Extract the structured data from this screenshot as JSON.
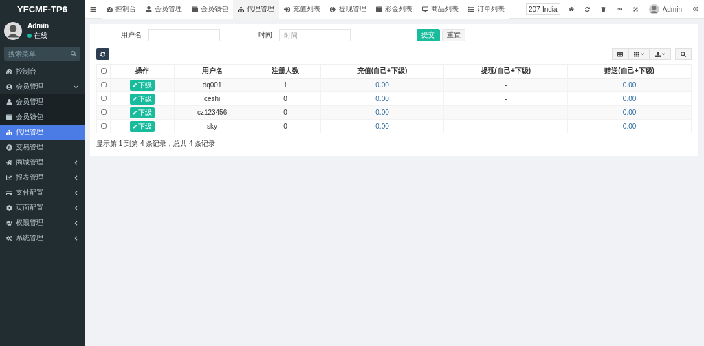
{
  "brand": "YFCMF-TP6",
  "user": {
    "name": "Admin",
    "status": "在线"
  },
  "sidebar": {
    "search": {
      "placeholder": "搜索菜单"
    },
    "items": [
      {
        "label": "控制台",
        "kind": "link",
        "selected": false
      },
      {
        "label": "会员管理",
        "kind": "group",
        "selected": false,
        "expanded": true,
        "children": [
          {
            "label": "会员管理",
            "selected": false
          },
          {
            "label": "会员钱包",
            "selected": false
          }
        ]
      },
      {
        "label": "代理管理",
        "kind": "link",
        "selected": true
      },
      {
        "label": "交易管理",
        "kind": "link",
        "selected": false
      },
      {
        "label": "商城管理",
        "kind": "group",
        "selected": false,
        "expanded": false
      },
      {
        "label": "报表管理",
        "kind": "group",
        "selected": false,
        "expanded": false
      },
      {
        "label": "支付配置",
        "kind": "group",
        "selected": false,
        "expanded": false
      },
      {
        "label": "页面配置",
        "kind": "group",
        "selected": false,
        "expanded": false
      },
      {
        "label": "权限管理",
        "kind": "group",
        "selected": false,
        "expanded": false
      },
      {
        "label": "系统管理",
        "kind": "group",
        "selected": false,
        "expanded": false
      }
    ]
  },
  "tabs": [
    {
      "label": "控制台",
      "selected": false
    },
    {
      "label": "会员管理",
      "selected": false
    },
    {
      "label": "会员钱包",
      "selected": false
    },
    {
      "label": "代理管理",
      "selected": true
    },
    {
      "label": "充值列表",
      "selected": false
    },
    {
      "label": "提现管理",
      "selected": false
    },
    {
      "label": "彩金列表",
      "selected": false
    },
    {
      "label": "商品列表",
      "selected": false
    },
    {
      "label": "订单列表",
      "selected": false
    }
  ],
  "header_right": {
    "language": "207-India",
    "user": "Admin"
  },
  "filters": [
    {
      "label": "用户名"
    },
    {
      "label": "时间",
      "placeholder": "时间"
    }
  ],
  "filter_buttons": [
    {
      "label": "提交",
      "kind": "primary"
    },
    {
      "label": "重置",
      "kind": "default"
    }
  ],
  "table": {
    "columns": [
      "操作",
      "用户名",
      "注册人数",
      "充值(自己+下级)",
      "提现(自己+下级)",
      "赠送(自己+下级)"
    ],
    "header_checked": false,
    "rows": [
      {
        "checked": false,
        "action": "下级",
        "username": "dq001",
        "registered": "1",
        "recharge": "0.00",
        "withdraw": "-",
        "bonus": "0.00"
      },
      {
        "checked": false,
        "action": "下级",
        "username": "ceshi",
        "registered": "0",
        "recharge": "0.00",
        "withdraw": "-",
        "bonus": "0.00"
      },
      {
        "checked": false,
        "action": "下级",
        "username": "cz123456",
        "registered": "0",
        "recharge": "0.00",
        "withdraw": "-",
        "bonus": "0.00"
      },
      {
        "checked": false,
        "action": "下级",
        "username": "sky",
        "registered": "0",
        "recharge": "0.00",
        "withdraw": "-",
        "bonus": "0.00"
      }
    ]
  },
  "pagination_info": "显示第 1 到第 4 条记录，总共 4 条记录"
}
